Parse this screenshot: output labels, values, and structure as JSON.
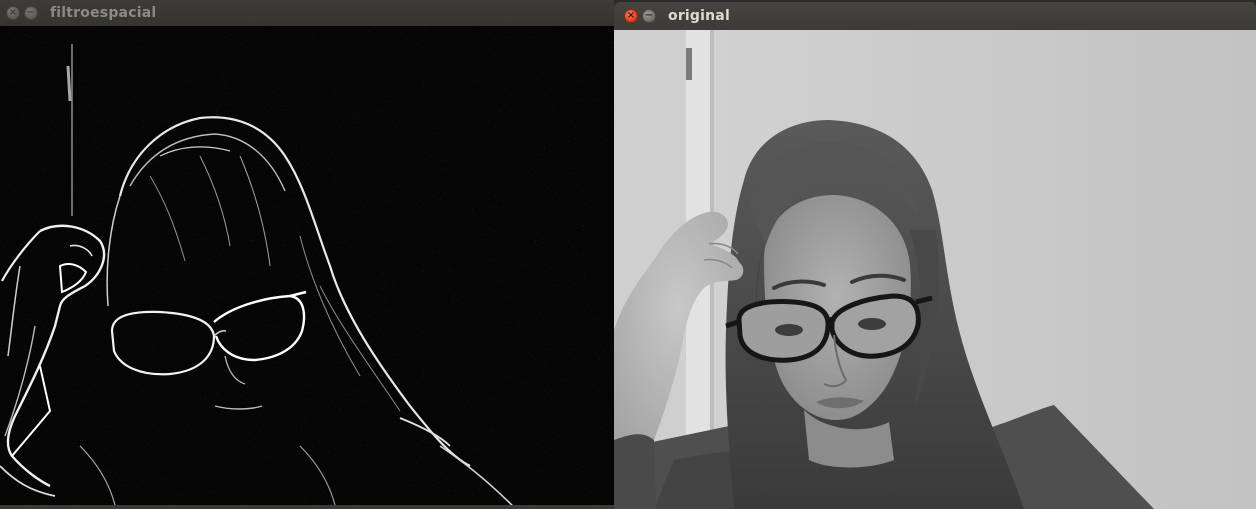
{
  "windows": {
    "filtro": {
      "title": "filtroespacial",
      "close_glyph": "×",
      "minimize_glyph": "−",
      "content": "edge-filtered-image"
    },
    "original": {
      "title": "original",
      "close_glyph": "×",
      "minimize_glyph": "−",
      "content": "grayscale-webcam-image"
    }
  },
  "colors": {
    "titlebar": "#3c3b37",
    "close_active": "#e0461a",
    "title_active_text": "#dfdbd2",
    "title_inactive_text": "#8b8a85",
    "filtered_background": "#050505"
  }
}
